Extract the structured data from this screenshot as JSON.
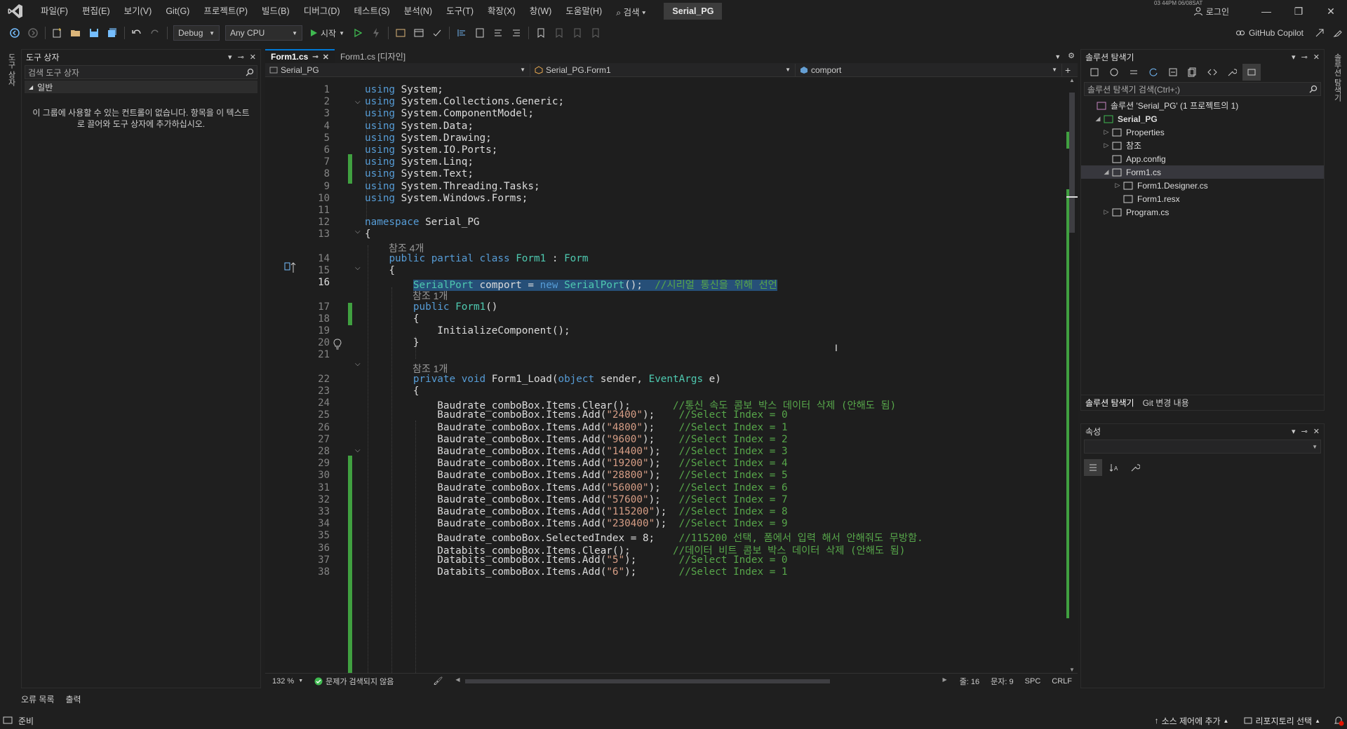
{
  "menubar": {
    "items": [
      "파일(F)",
      "편집(E)",
      "보기(V)",
      "Git(G)",
      "프로젝트(P)",
      "빌드(B)",
      "디버그(D)",
      "테스트(S)",
      "분석(N)",
      "도구(T)",
      "확장(X)",
      "창(W)",
      "도움말(H)"
    ],
    "search_label": "⌕ 검색 ▾",
    "project_name": "Serial_PG",
    "clock_text": "03 44PM 06/08SAT",
    "login_label": "로그인"
  },
  "toolbar": {
    "config": "Debug",
    "platform": "Any CPU",
    "start_label": "시작",
    "copilot_label": "GitHub Copilot"
  },
  "side_tabs": {
    "left": "도구 상자",
    "right": "솔루션 탐색기"
  },
  "toolbox": {
    "title": "도구 상자",
    "search_placeholder": "검색 도구 상자",
    "group_label": "일반",
    "empty_message": "이 그룹에 사용할 수 있는 컨트롤이 없습니다. 항목을 이 텍스트로 끌어와 도구 상자에 추가하십시오."
  },
  "bottom_tabs": [
    "오류 목록",
    "출력"
  ],
  "editor": {
    "tabs": [
      {
        "label": "Form1.cs",
        "pin": "⊸",
        "close": "✕"
      },
      {
        "label": "Form1.cs [디자인]"
      }
    ],
    "nav": {
      "project": "Serial_PG",
      "class": "Serial_PG.Form1",
      "member": "comport"
    },
    "meta_lines": {
      "refs4": "참조 4개",
      "refs1": "참조 1개"
    },
    "lines": [
      {
        "n": "1",
        "parts": [
          [
            "kw",
            "using"
          ],
          [
            "tx",
            " System;"
          ]
        ]
      },
      {
        "n": "2",
        "parts": [
          [
            "kw",
            "using"
          ],
          [
            "tx",
            " System.Collections.Generic;"
          ]
        ]
      },
      {
        "n": "3",
        "parts": [
          [
            "kw",
            "using"
          ],
          [
            "tx",
            " System.ComponentModel;"
          ]
        ]
      },
      {
        "n": "4",
        "parts": [
          [
            "kw",
            "using"
          ],
          [
            "tx",
            " System.Data;"
          ]
        ]
      },
      {
        "n": "5",
        "parts": [
          [
            "kw",
            "using"
          ],
          [
            "tx",
            " System.Drawing;"
          ]
        ]
      },
      {
        "n": "6",
        "parts": [
          [
            "kw",
            "using"
          ],
          [
            "tx",
            " System.IO.Ports;"
          ]
        ]
      },
      {
        "n": "7",
        "parts": [
          [
            "kw",
            "using"
          ],
          [
            "tx",
            " System.Linq;"
          ]
        ]
      },
      {
        "n": "8",
        "parts": [
          [
            "kw",
            "using"
          ],
          [
            "tx",
            " System.Text;"
          ]
        ]
      },
      {
        "n": "9",
        "parts": [
          [
            "kw",
            "using"
          ],
          [
            "tx",
            " System.Threading.Tasks;"
          ]
        ]
      },
      {
        "n": "10",
        "parts": [
          [
            "kw",
            "using"
          ],
          [
            "tx",
            " System.Windows.Forms;"
          ]
        ]
      },
      {
        "n": "11",
        "parts": []
      },
      {
        "n": "12",
        "parts": [
          [
            "kw",
            "namespace"
          ],
          [
            "tx",
            " Serial_PG"
          ]
        ]
      },
      {
        "n": "13",
        "parts": [
          [
            "tx",
            "{"
          ]
        ]
      },
      {
        "n": "14",
        "parts": [
          [
            "tx",
            "    "
          ],
          [
            "kw",
            "public partial class"
          ],
          [
            "tx",
            " "
          ],
          [
            "ty",
            "Form1"
          ],
          [
            "tx",
            " : "
          ],
          [
            "ty",
            "Form"
          ]
        ]
      },
      {
        "n": "15",
        "parts": [
          [
            "tx",
            "    {"
          ]
        ]
      },
      {
        "n": "16",
        "parts": [
          [
            "tx",
            "        "
          ],
          [
            "ty sel",
            "SerialPort"
          ],
          [
            "tx sel",
            " comport = "
          ],
          [
            "kw sel",
            "new"
          ],
          [
            "tx sel",
            " "
          ],
          [
            "ty sel",
            "SerialPort"
          ],
          [
            "tx sel",
            "();  "
          ],
          [
            "cm sel",
            "//시리얼 통신을 위해 선언"
          ]
        ]
      },
      {
        "n": "17",
        "parts": [
          [
            "tx",
            "        "
          ],
          [
            "kw",
            "public"
          ],
          [
            "tx",
            " "
          ],
          [
            "ty",
            "Form1"
          ],
          [
            "tx",
            "()"
          ]
        ]
      },
      {
        "n": "18",
        "parts": [
          [
            "tx",
            "        {"
          ]
        ]
      },
      {
        "n": "19",
        "parts": [
          [
            "tx",
            "            InitializeComponent();"
          ]
        ]
      },
      {
        "n": "20",
        "parts": [
          [
            "tx",
            "        }"
          ]
        ]
      },
      {
        "n": "21",
        "parts": []
      },
      {
        "n": "22",
        "parts": [
          [
            "tx",
            "        "
          ],
          [
            "kw",
            "private void"
          ],
          [
            "tx",
            " Form1_Load("
          ],
          [
            "kw",
            "object"
          ],
          [
            "tx",
            " sender, "
          ],
          [
            "ty",
            "EventArgs"
          ],
          [
            "tx",
            " e)"
          ]
        ]
      },
      {
        "n": "23",
        "parts": [
          [
            "tx",
            "        {"
          ]
        ]
      },
      {
        "n": "24",
        "parts": [
          [
            "tx",
            "            Baudrate_comboBox.Items.Clear();       "
          ],
          [
            "cm",
            "//통신 속도 콤보 박스 데이터 삭제 (안해도 됨)"
          ]
        ]
      },
      {
        "n": "25",
        "parts": [
          [
            "tx",
            "            Baudrate_comboBox.Items.Add("
          ],
          [
            "st",
            "\"2400\""
          ],
          [
            "tx",
            ");    "
          ],
          [
            "cm",
            "//Select Index = 0"
          ]
        ]
      },
      {
        "n": "26",
        "parts": [
          [
            "tx",
            "            Baudrate_comboBox.Items.Add("
          ],
          [
            "st",
            "\"4800\""
          ],
          [
            "tx",
            ");    "
          ],
          [
            "cm",
            "//Select Index = 1"
          ]
        ]
      },
      {
        "n": "27",
        "parts": [
          [
            "tx",
            "            Baudrate_comboBox.Items.Add("
          ],
          [
            "st",
            "\"9600\""
          ],
          [
            "tx",
            ");    "
          ],
          [
            "cm",
            "//Select Index = 2"
          ]
        ]
      },
      {
        "n": "28",
        "parts": [
          [
            "tx",
            "            Baudrate_comboBox.Items.Add("
          ],
          [
            "st",
            "\"14400\""
          ],
          [
            "tx",
            ");   "
          ],
          [
            "cm",
            "//Select Index = 3"
          ]
        ]
      },
      {
        "n": "29",
        "parts": [
          [
            "tx",
            "            Baudrate_comboBox.Items.Add("
          ],
          [
            "st",
            "\"19200\""
          ],
          [
            "tx",
            ");   "
          ],
          [
            "cm",
            "//Select Index = 4"
          ]
        ]
      },
      {
        "n": "30",
        "parts": [
          [
            "tx",
            "            Baudrate_comboBox.Items.Add("
          ],
          [
            "st",
            "\"28800\""
          ],
          [
            "tx",
            ");   "
          ],
          [
            "cm",
            "//Select Index = 5"
          ]
        ]
      },
      {
        "n": "31",
        "parts": [
          [
            "tx",
            "            Baudrate_comboBox.Items.Add("
          ],
          [
            "st",
            "\"56000\""
          ],
          [
            "tx",
            ");   "
          ],
          [
            "cm",
            "//Select Index = 6"
          ]
        ]
      },
      {
        "n": "32",
        "parts": [
          [
            "tx",
            "            Baudrate_comboBox.Items.Add("
          ],
          [
            "st",
            "\"57600\""
          ],
          [
            "tx",
            ");   "
          ],
          [
            "cm",
            "//Select Index = 7"
          ]
        ]
      },
      {
        "n": "33",
        "parts": [
          [
            "tx",
            "            Baudrate_comboBox.Items.Add("
          ],
          [
            "st",
            "\"115200\""
          ],
          [
            "tx",
            ");  "
          ],
          [
            "cm",
            "//Select Index = 8"
          ]
        ]
      },
      {
        "n": "34",
        "parts": [
          [
            "tx",
            "            Baudrate_comboBox.Items.Add("
          ],
          [
            "st",
            "\"230400\""
          ],
          [
            "tx",
            ");  "
          ],
          [
            "cm",
            "//Select Index = 9"
          ]
        ]
      },
      {
        "n": "35",
        "parts": [
          [
            "tx",
            "            Baudrate_comboBox.SelectedIndex = 8;    "
          ],
          [
            "cm",
            "//115200 선택, 폼에서 입력 해서 안해줘도 무방함."
          ]
        ]
      },
      {
        "n": "36",
        "parts": [
          [
            "tx",
            "            Databits_comboBox.Items.Clear();       "
          ],
          [
            "cm",
            "//데이터 비트 콤보 박스 데이터 삭제 (안해도 됨)"
          ]
        ]
      },
      {
        "n": "37",
        "parts": [
          [
            "tx",
            "            Databits_comboBox.Items.Add("
          ],
          [
            "st",
            "\"5\""
          ],
          [
            "tx",
            ");       "
          ],
          [
            "cm",
            "//Select Index = 0"
          ]
        ]
      },
      {
        "n": "38",
        "parts": [
          [
            "tx",
            "            Databits_comboBox.Items.Add("
          ],
          [
            "st",
            "\"6\""
          ],
          [
            "tx",
            ");       "
          ],
          [
            "cm",
            "//Select Index = 1"
          ]
        ]
      }
    ],
    "status": {
      "zoom": "132 %",
      "issues": "문제가 검색되지 않음",
      "line": "줄: 16",
      "col": "문자: 9",
      "spc": "SPC",
      "eol": "CRLF"
    }
  },
  "solution_explorer": {
    "title": "솔루션 탐색기",
    "search_placeholder": "솔루션 탐색기 검색(Ctrl+;)",
    "tree": [
      {
        "label": "솔루션 'Serial_PG' (1 프로젝트의 1)",
        "exp": "",
        "icon": "solution-icon"
      },
      {
        "label": "Serial_PG",
        "exp": "◢",
        "icon": "csharp-project-icon",
        "bold": true
      },
      {
        "label": "Properties",
        "exp": "▷",
        "icon": "wrench-icon"
      },
      {
        "label": "참조",
        "exp": "▷",
        "icon": "references-icon"
      },
      {
        "label": "App.config",
        "exp": "",
        "icon": "config-file-icon"
      },
      {
        "label": "Form1.cs",
        "exp": "◢",
        "icon": "form-icon",
        "selected": true
      },
      {
        "label": "Form1.Designer.cs",
        "exp": "▷",
        "icon": "cs-file-icon"
      },
      {
        "label": "Form1.resx",
        "exp": "",
        "icon": "resx-file-icon"
      },
      {
        "label": "Program.cs",
        "exp": "▷",
        "icon": "cs-file-icon"
      }
    ],
    "tabs": [
      "솔루션 탐색기",
      "Git 변경 내용"
    ]
  },
  "properties": {
    "title": "속성"
  },
  "statusbar": {
    "ready": "준비",
    "source_control": "소스 제어에 추가",
    "repo": "리포지토리 선택"
  },
  "colors": {
    "background": "#1f1f1f",
    "editor_bg": "#1e1e1e",
    "keyword": "#569cd6",
    "type": "#4ec9b0",
    "comment": "#57a64a",
    "string": "#d69d85",
    "selection": "#264f78",
    "change_bar": "#40a040",
    "accent": "#0078d4"
  }
}
